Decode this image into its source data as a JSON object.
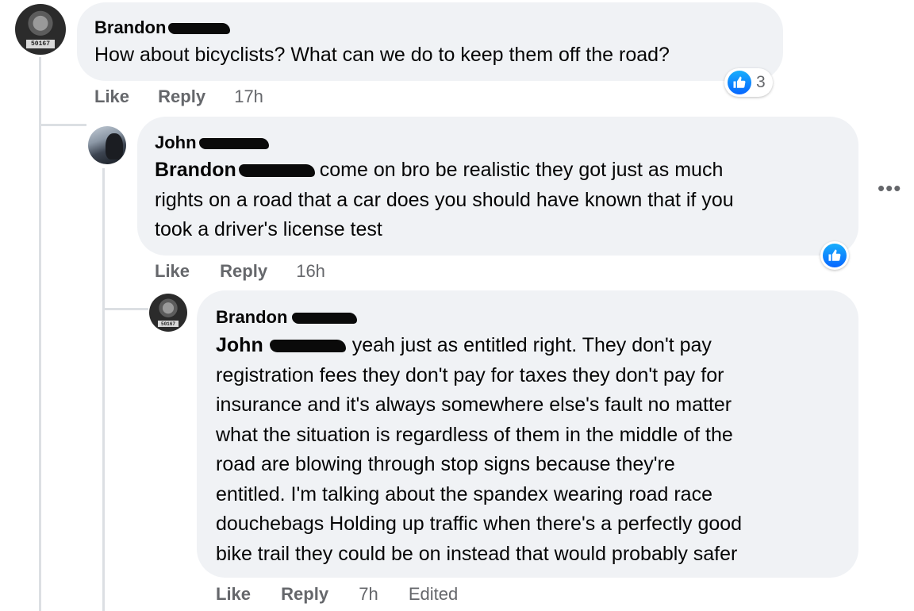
{
  "comments": [
    {
      "author": "Brandon",
      "text": "How about bicyclists? What can we do to keep them off the road?",
      "avatar_plate": "50167",
      "actions": {
        "like": "Like",
        "reply": "Reply",
        "time": "17h"
      },
      "reactions": {
        "icon": "thumbs-up-icon",
        "count": "3"
      }
    },
    {
      "author": "John",
      "mention": "Brandon",
      "text_lines": [
        "come on bro be realistic they got just as much",
        "rights on a road that a car does you should have known that if you",
        "took a driver's license test"
      ],
      "actions": {
        "like": "Like",
        "reply": "Reply",
        "time": "16h"
      },
      "reactions": {
        "icon": "thumbs-up-icon"
      }
    },
    {
      "author": "Brandon",
      "mention": "John",
      "avatar_plate": "50167",
      "text_lines": [
        "yeah just as entitled right. They don't pay",
        "registration fees they don't pay for taxes they don't pay for",
        "insurance and it's always somewhere else's fault no matter",
        "what the situation is regardless of them in the middle of the",
        "road are blowing through stop signs because they're",
        "entitled. I'm talking about the spandex wearing road race",
        "douchebags Holding up traffic when there's a perfectly good",
        "bike trail they could be on instead that would probably safer"
      ],
      "actions": {
        "like": "Like",
        "reply": "Reply",
        "time": "7h",
        "edited": "Edited"
      }
    }
  ],
  "colors": {
    "bubble": "#f0f2f5",
    "meta": "#65676b",
    "like_blue": "#0766ff",
    "thread": "#dcdfe3"
  }
}
